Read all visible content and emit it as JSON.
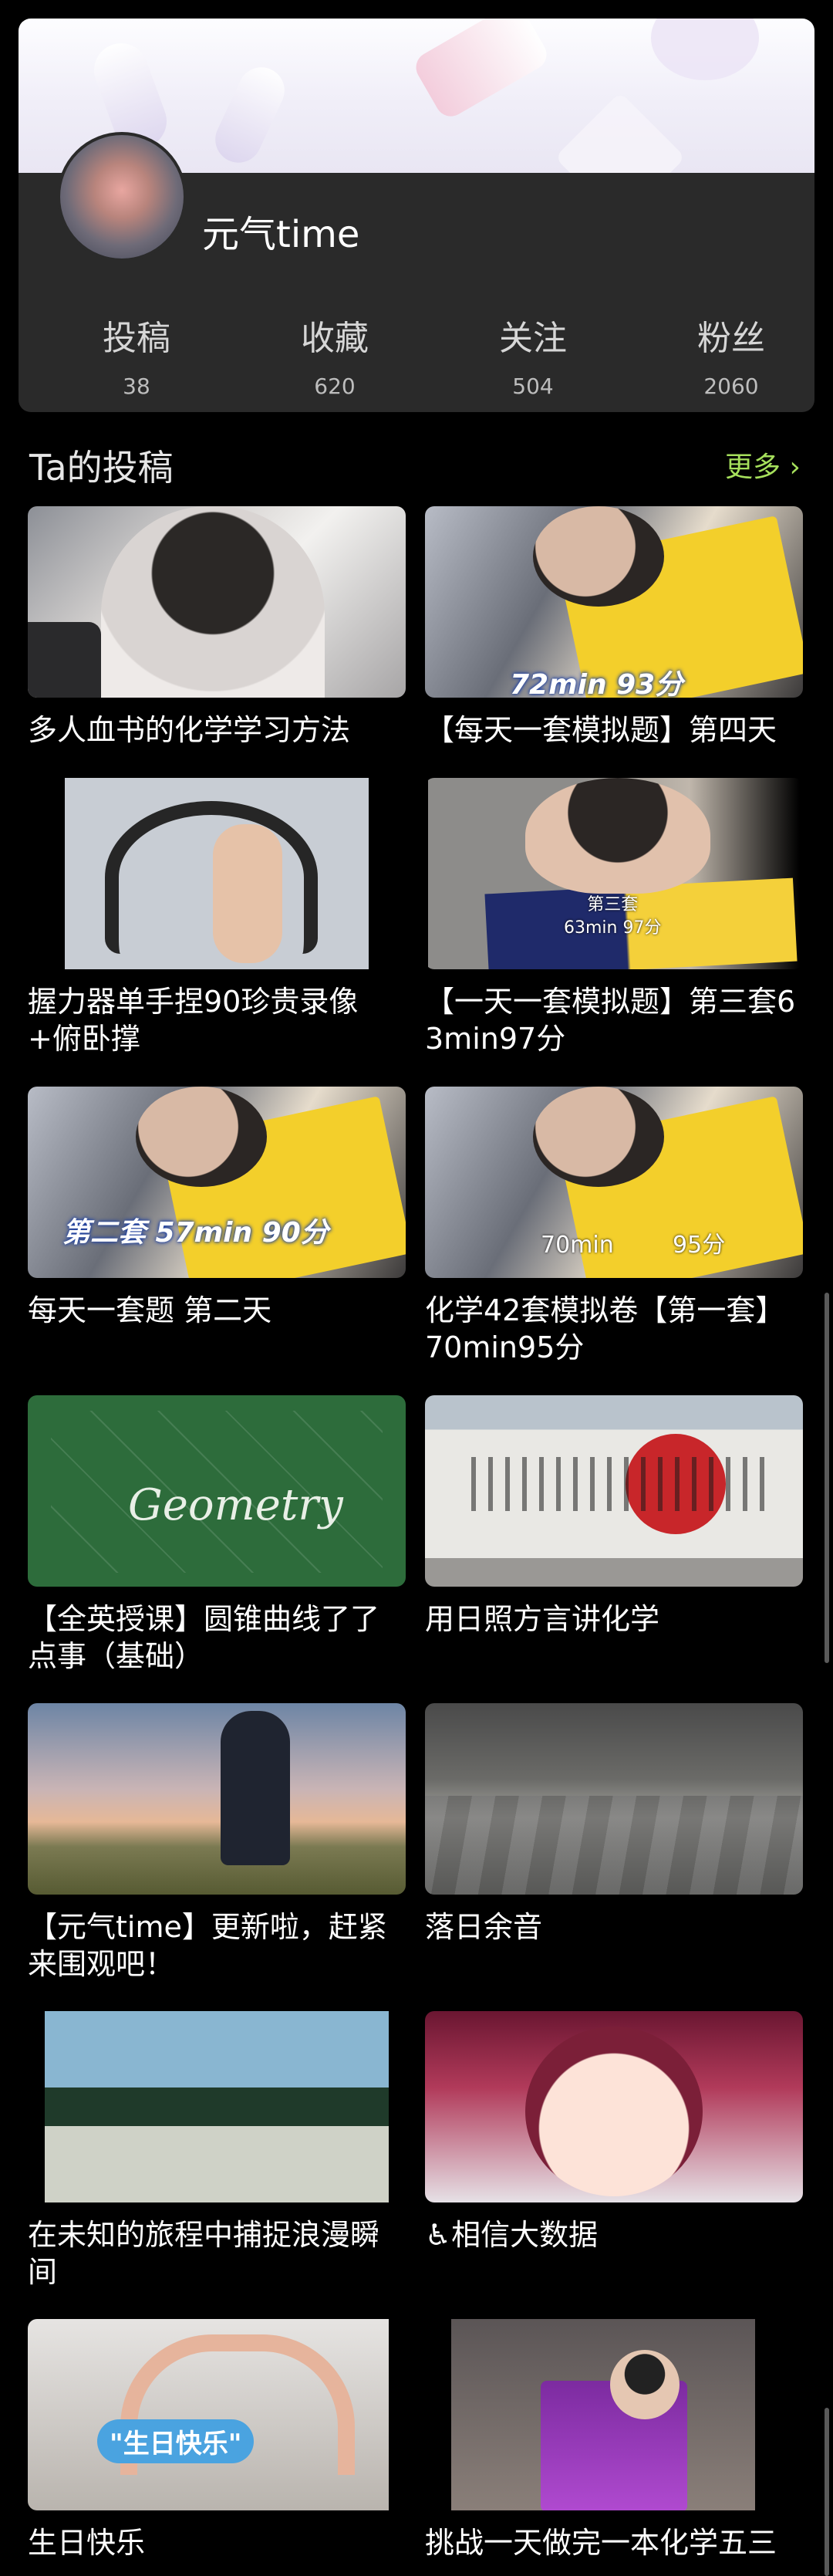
{
  "profile": {
    "username": "元气time",
    "stats": [
      {
        "label": "投稿",
        "value": "38"
      },
      {
        "label": "收藏",
        "value": "620"
      },
      {
        "label": "关注",
        "value": "504"
      },
      {
        "label": "粉丝",
        "value": "2060"
      }
    ]
  },
  "section": {
    "title": "Ta的投稿",
    "more_label": "更多 ›"
  },
  "videos": [
    {
      "title": "多人血书的化学学习方法",
      "overlay": ""
    },
    {
      "title": "【每天一套模拟题】第四天",
      "overlay": "72min 93分"
    },
    {
      "title": "握力器单手捏90珍贵录像+俯卧撑",
      "overlay": ""
    },
    {
      "title": "【一天一套模拟题】第三套63min97分",
      "overlay": "第三套\n63min 97分"
    },
    {
      "title": "每天一套题 第二天",
      "overlay": "第二套 57min 90分"
    },
    {
      "title": "化学42套模拟卷【第一套】70min95分",
      "overlay": "70min        95分"
    },
    {
      "title": "【全英授课】圆锥曲线了了点事（基础）",
      "overlay": ""
    },
    {
      "title": "用日照方言讲化学",
      "overlay": ""
    },
    {
      "title": "【元气time】更新啦，赶紧来围观吧！",
      "overlay": ""
    },
    {
      "title": "落日余音",
      "overlay": ""
    },
    {
      "title": "在未知的旅程中捕捉浪漫瞬间",
      "overlay": ""
    },
    {
      "title": "♿相信大数据",
      "overlay": ""
    },
    {
      "title": "生日快乐",
      "overlay": ""
    },
    {
      "title": "挑战一天做完一本化学五三",
      "overlay": ""
    }
  ]
}
